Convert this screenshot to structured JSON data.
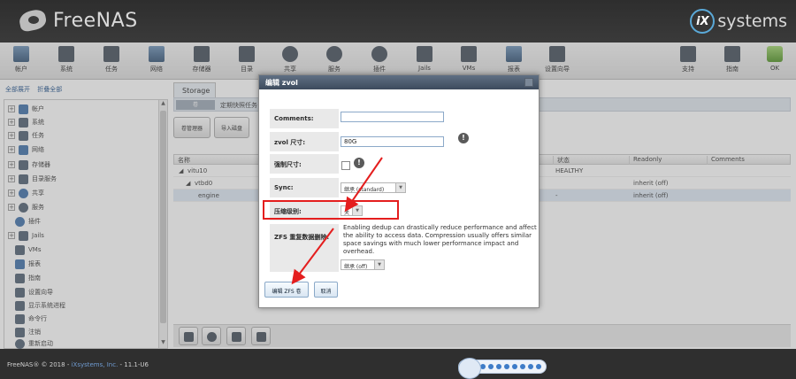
{
  "header": {
    "logo_text": "FreeNAS",
    "vendor_text": "systems",
    "vendor_mark": "iX"
  },
  "toolbar": {
    "items": [
      {
        "label": "帐户",
        "icon": "users-icon"
      },
      {
        "label": "系统",
        "icon": "system-icon"
      },
      {
        "label": "任务",
        "icon": "tasks-icon"
      },
      {
        "label": "网络",
        "icon": "network-icon"
      },
      {
        "label": "存储器",
        "icon": "storage-icon"
      },
      {
        "label": "目录",
        "icon": "directory-icon"
      },
      {
        "label": "共享",
        "icon": "sharing-icon"
      },
      {
        "label": "服务",
        "icon": "services-icon"
      },
      {
        "label": "插件",
        "icon": "plugins-icon"
      },
      {
        "label": "Jails",
        "icon": "jails-icon"
      },
      {
        "label": "VMs",
        "icon": "vms-icon"
      },
      {
        "label": "报表",
        "icon": "reports-icon"
      },
      {
        "label": "设置向导",
        "icon": "wizard-icon"
      },
      {
        "label": "支持",
        "icon": "support-icon"
      },
      {
        "label": "指南",
        "icon": "guide-icon"
      },
      {
        "label": "OK",
        "icon": "alert-ok-icon"
      }
    ]
  },
  "sidebar": {
    "expand_all": "全部展开",
    "collapse_all": "折叠全部",
    "items": [
      {
        "label": "帐户",
        "expandable": true
      },
      {
        "label": "系统",
        "expandable": true
      },
      {
        "label": "任务",
        "expandable": true
      },
      {
        "label": "网络",
        "expandable": true
      },
      {
        "label": "存储器",
        "expandable": true
      },
      {
        "label": "目录服务",
        "expandable": true
      },
      {
        "label": "共享",
        "expandable": true
      },
      {
        "label": "服务",
        "expandable": true
      },
      {
        "label": "插件",
        "expandable": false
      },
      {
        "label": "Jails",
        "expandable": true
      },
      {
        "label": "VMs",
        "expandable": false
      },
      {
        "label": "报表",
        "expandable": false
      },
      {
        "label": "指南",
        "expandable": false
      },
      {
        "label": "设置向导",
        "expandable": false
      },
      {
        "label": "显示系统进程",
        "expandable": false
      },
      {
        "label": "命令行",
        "expandable": false
      },
      {
        "label": "注销",
        "expandable": false
      },
      {
        "label": "重新启动",
        "expandable": false
      }
    ]
  },
  "main": {
    "tab_label": "Storage",
    "subtab_label": "卷",
    "subtab_text": "定期快照任务",
    "buttons": [
      "卷管理器",
      "导入磁盘"
    ],
    "grid": {
      "headers": [
        "名称",
        "状态",
        "Readonly",
        "Comments"
      ],
      "rows": [
        {
          "name": "vitu10",
          "status": "HEALTHY",
          "readonly": "",
          "comments": ""
        },
        {
          "name": "vtbd0",
          "status": "",
          "readonly": "inherit (off)",
          "comments": ""
        },
        {
          "name": "engine",
          "status": "-",
          "readonly": "inherit (off)",
          "comments": ""
        }
      ]
    }
  },
  "dialog": {
    "title": "编辑 zvol",
    "comments_label": "Comments:",
    "comments_value": "",
    "size_label": "zvol 尺寸:",
    "size_value": "80G",
    "force_label": "强制尺寸:",
    "sync_label": "Sync:",
    "sync_value": "继承 (standard)",
    "compression_label": "压缩级别:",
    "compression_value": "关",
    "dedup_label": "ZFS 重复数据删除:",
    "dedup_desc": "Enabling dedup can drastically reduce performance and affect the ability to access data. Compression usually offers similar space savings with much lower performance impact and overhead.",
    "dedup_value": "继承 (off)",
    "save_button": "编辑 ZFS 卷",
    "cancel_button": "取消"
  },
  "footer": {
    "text_prefix": "FreeNAS® © 2018 - ",
    "link": "iXsystems, Inc.",
    "text_suffix": " - 11.1-U6"
  }
}
